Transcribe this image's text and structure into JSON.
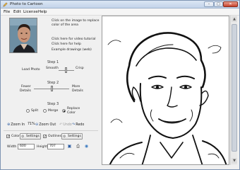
{
  "window": {
    "title": "Photo to Cartoon",
    "minimize": "–",
    "maximize": "□",
    "close": "✕"
  },
  "menu": [
    "File",
    "Edit",
    "License",
    "Help"
  ],
  "info_links": [
    "Click on the image to replace",
    "color of the area",
    "Click here for video tutorial",
    "Click here for help",
    "Example drawings (web)"
  ],
  "step1": {
    "title": "Step 1",
    "load": "Load Photo",
    "smooth": "Smooth",
    "crisp": "Crisp",
    "level": 0.45
  },
  "step2": {
    "title": "Step 2",
    "fewer_a": "Fewer",
    "fewer_b": "Details",
    "more_a": "More",
    "more_b": "Details",
    "level": 0.5
  },
  "step3": {
    "title": "Step 3",
    "split": "Split",
    "merge": "Merge",
    "replace_a": "Replace",
    "replace_b": "Color",
    "selected": "replace"
  },
  "toolbar": {
    "zoom_in": "Zoom In",
    "zoom_pct": "71%",
    "zoom_out": "Zoom Out",
    "undo": "Undo",
    "redo": "Redo"
  },
  "options": {
    "color": "Color",
    "settings1": "Settings",
    "outlines": "Outlines",
    "settings2": "Settings",
    "color_checked": true,
    "outlines_checked": true
  },
  "size": {
    "width_label": "Width",
    "width_value": "600",
    "height_label": "Height",
    "height_value": "707"
  }
}
